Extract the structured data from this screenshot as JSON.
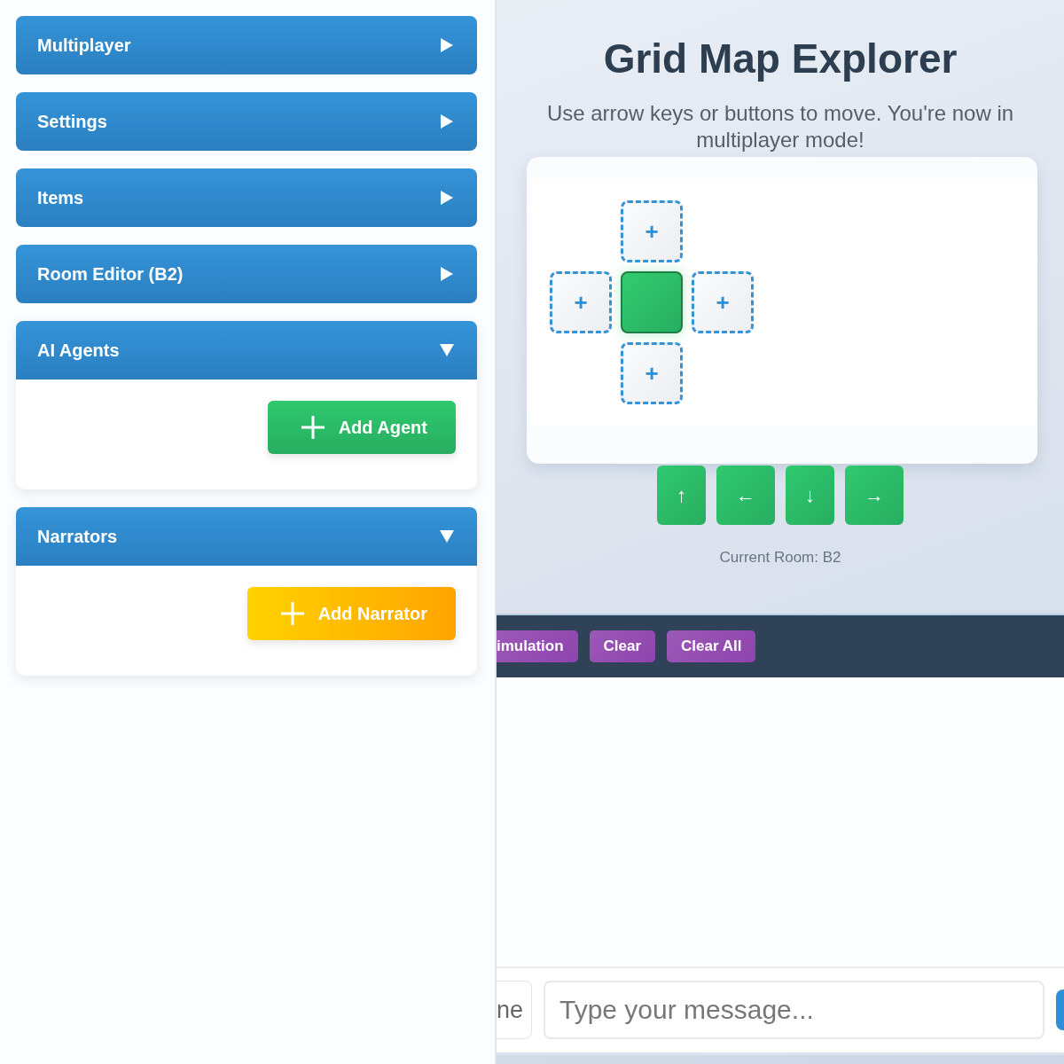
{
  "sidebar": {
    "panels": [
      {
        "title": "Multiplayer",
        "expanded": false
      },
      {
        "title": "Settings",
        "expanded": false
      },
      {
        "title": "Items",
        "expanded": false
      },
      {
        "title": "Room Editor (B2)",
        "expanded": false
      },
      {
        "title": "AI Agents",
        "expanded": true,
        "action": {
          "label": "Add Agent",
          "kind": "agent"
        }
      },
      {
        "title": "Narrators",
        "expanded": true,
        "action": {
          "label": "Add Narrator",
          "kind": "narrator"
        }
      }
    ]
  },
  "map": {
    "title": "Grid Map Explorer",
    "subtitle": "Use arrow keys or buttons to move. You're now in multiplayer mode!",
    "grid_rows": [
      [
        {
          "kind": "blank"
        },
        {
          "kind": "empty",
          "label": "+"
        },
        {
          "kind": "blank"
        }
      ],
      [
        {
          "kind": "empty",
          "label": "+"
        },
        {
          "kind": "current"
        },
        {
          "kind": "empty",
          "label": "+"
        }
      ],
      [
        {
          "kind": "blank"
        },
        {
          "kind": "empty",
          "label": "+"
        },
        {
          "kind": "blank"
        }
      ]
    ],
    "move_buttons": [
      "↑",
      "←",
      "↓",
      "→"
    ],
    "status": "Current Room: B2"
  },
  "toolbar": {
    "buttons": [
      "imulation",
      "Clear",
      "Clear All"
    ]
  },
  "chat": {
    "name_field": {
      "value": "ne"
    },
    "message_field": {
      "placeholder": "Type your message..."
    }
  }
}
